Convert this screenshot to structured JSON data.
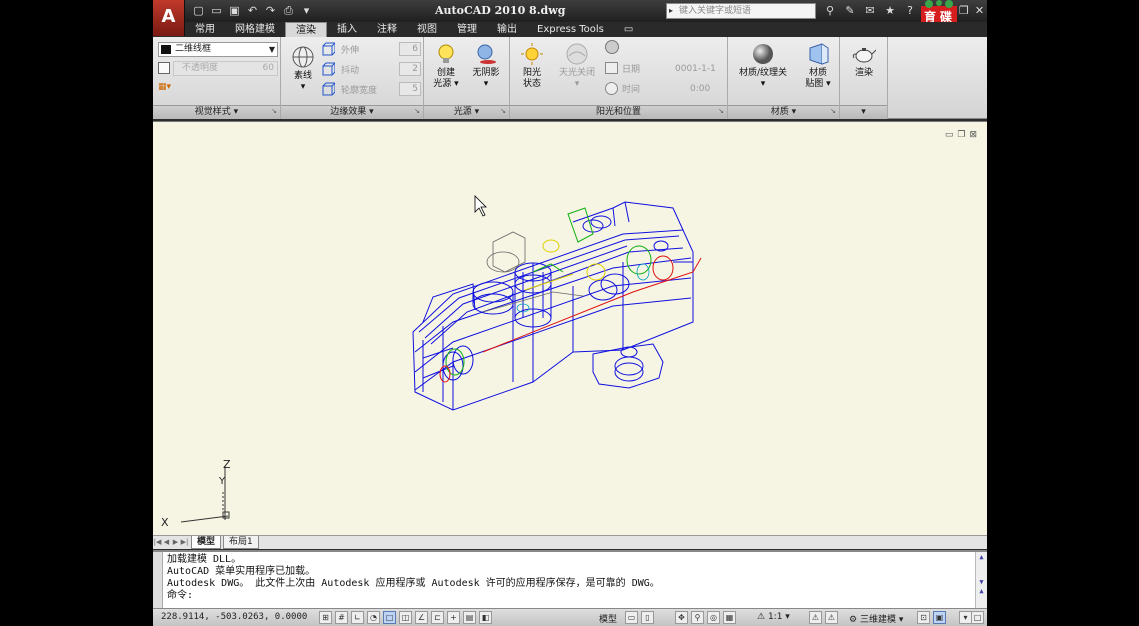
{
  "app": {
    "logo_letter": "A",
    "title": "AutoCAD 2010   8.dwg",
    "search_placeholder": "键入关键字或短语",
    "brand_line1": "育",
    "brand_line2": "碟",
    "brand_line3": "教",
    "brand_line4": "育"
  },
  "tabs": [
    {
      "label": "常用"
    },
    {
      "label": "网格建模"
    },
    {
      "label": "渲染",
      "active": true
    },
    {
      "label": "插入"
    },
    {
      "label": "注释"
    },
    {
      "label": "视图"
    },
    {
      "label": "管理"
    },
    {
      "label": "输出"
    },
    {
      "label": "Express Tools"
    }
  ],
  "ribbon": {
    "visual_styles": {
      "combo_value": "二维线框",
      "gray_label": "不透明度",
      "gray_value": "60",
      "title": "视觉样式"
    },
    "edge_effects": {
      "line_label": "素线",
      "extend_label": "外伸",
      "extend_value": "6",
      "jitter_label": "抖动",
      "jitter_value": "2",
      "silhouette_label": "轮廓宽度",
      "silhouette_value": "5",
      "title": "边缘效果"
    },
    "lights": {
      "create_label": "创建",
      "create_label2": "光源",
      "shadow_label": "无阴影",
      "title": "光源"
    },
    "sun": {
      "status_label": "阳光",
      "status_label2": "状态",
      "sky_label": "天光关闭",
      "date_label": "日期",
      "date_value": "0001-1-1",
      "time_label": "时间",
      "time_value": "0:00",
      "title": "阳光和位置"
    },
    "materials": {
      "mat_label": "材质/纹理关",
      "map_label": "材质",
      "map_label2": "贴图",
      "title": "材质"
    },
    "render": {
      "label": "渲染"
    }
  },
  "layout_tabs": [
    {
      "label": "模型",
      "active": true
    },
    {
      "label": "布局1"
    }
  ],
  "command": {
    "lines": [
      "加载建模 DLL。",
      "AutoCAD 菜单实用程序已加载。",
      "Autodesk DWG。   此文件上次由 Autodesk 应用程序或 Autodesk 许可的应用程序保存，是可靠的 DWG。",
      "命令:"
    ]
  },
  "status": {
    "coords": "228.9114, -503.0263, 0.0000",
    "model_label": "模型",
    "scale_label": "1:1",
    "workspace_label": "三维建模"
  },
  "ucs": {
    "x_label": "X",
    "y_label": "Y",
    "z_label": "Z"
  },
  "colors": {
    "viewport_bg": "#f6f5e4",
    "wireframe_blue": "#1010e0",
    "accent_red": "#c0392b"
  }
}
